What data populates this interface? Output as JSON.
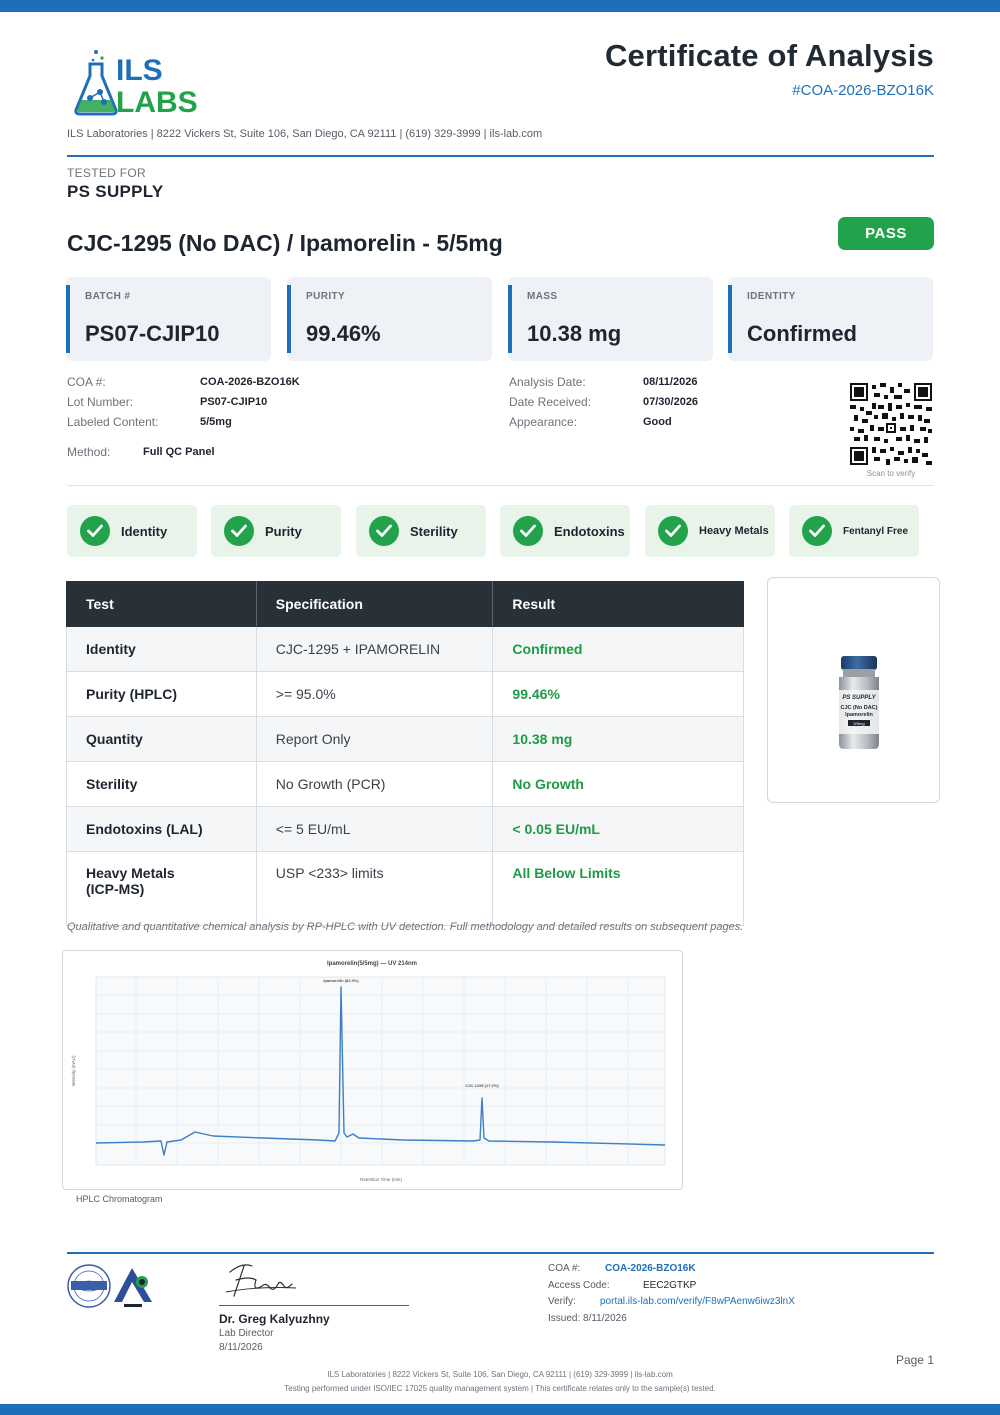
{
  "header": {
    "logo_line1": "ILS",
    "logo_line2": "LABS",
    "title": "Certificate of Analysis",
    "coa_id": "#COA-2026-BZO16K",
    "address": "ILS Laboratories  |  8222 Vickers St, Suite 106, San Diego, CA 92111  |  (619) 329-3999  |  ils-lab.com"
  },
  "client": {
    "label": "TESTED FOR",
    "name": "PS SUPPLY"
  },
  "product": {
    "name": "CJC-1295 (No DAC) / Ipamorelin - 5/5mg",
    "status": "PASS"
  },
  "cards": [
    {
      "label": "BATCH #",
      "value": "PS07-CJIP10"
    },
    {
      "label": "PURITY",
      "value": "99.46%"
    },
    {
      "label": "MASS",
      "value": "10.38 mg"
    },
    {
      "label": "IDENTITY",
      "value": "Confirmed"
    }
  ],
  "meta": {
    "left": [
      {
        "key": "COA #:",
        "value": "COA-2026-BZO16K"
      },
      {
        "key": "Lot Number:",
        "value": "PS07-CJIP10"
      },
      {
        "key": "Labeled Content:",
        "value": "5/5mg"
      }
    ],
    "right": [
      {
        "key": "Analysis Date:",
        "value": "08/11/2026"
      },
      {
        "key": "Date Received:",
        "value": "07/30/2026"
      },
      {
        "key": "Appearance:",
        "value": "Good"
      }
    ],
    "method_key": "Method:",
    "method_value": "Full QC Panel",
    "scan_label": "Scan to verify"
  },
  "checks": [
    "Identity",
    "Purity",
    "Sterility",
    "Endotoxins",
    "Heavy Metals",
    "Fentanyl Free"
  ],
  "table": {
    "headers": [
      "Test",
      "Specification",
      "Result"
    ],
    "rows": [
      {
        "test": "Identity",
        "spec": "CJC-1295 + IPAMORELIN",
        "result": "Confirmed"
      },
      {
        "test": "Purity (HPLC)",
        "spec": ">= 95.0%",
        "result": "99.46%"
      },
      {
        "test": "Quantity",
        "spec": "Report Only",
        "result": "10.38 mg"
      },
      {
        "test": "Sterility",
        "spec": "No Growth (PCR)",
        "result": "No Growth"
      },
      {
        "test": "Endotoxins (LAL)",
        "spec": "<= 5 EU/mL",
        "result": "< 0.05 EU/mL"
      },
      {
        "test": "Heavy Metals (ICP-MS)",
        "spec": "USP <233> limits",
        "result": "All Below Limits"
      }
    ]
  },
  "vial": {
    "brand": "PS SUPPLY",
    "line1": "CJC (No DAC)",
    "line2": "Ipamorelin",
    "line3": "5/5mg"
  },
  "note": "Qualitative and quantitative chemical analysis by RP-HPLC with UV detection. Full methodology and detailed results on subsequent pages.",
  "chromatogram": {
    "caption": "HPLC Chromatogram",
    "title": "Ipamorelin(5/5mg) — UV 214nm",
    "xlabel": "Retention Time (min)",
    "ylabel": "Intensity (mAU)",
    "peak1_label": "Ipamorelin (82.3%)",
    "peak2_label": "CJC-1295 (17.2%)"
  },
  "footer": {
    "signer": "Dr. Greg Kalyuzhny",
    "role": "Lab Director",
    "sign_date": "8/11/2026",
    "coa_key": "COA #:",
    "coa_value": "COA-2026-BZO16K",
    "access_key": "Access Code:",
    "access_value": "EEC2GTKP",
    "verify_key": "Verify:",
    "verify_value": "portal.ils-lab.com/verify/F8wPAenw6iwz3lnX",
    "issued": "Issued: 8/11/2026",
    "page": "Page 1",
    "line1": "ILS Laboratories  |  8222 Vickers St, Suite 106, San Diego, CA 92111  |  (619) 329-3999  |  ils-lab.com",
    "line2": "Testing performed under ISO/IEC 17025 quality management system  |  This certificate relates only to the sample(s) tested."
  },
  "colors": {
    "brand_blue": "#1f6fb8",
    "pass_green": "#22a24a",
    "header_dark": "#283038"
  }
}
